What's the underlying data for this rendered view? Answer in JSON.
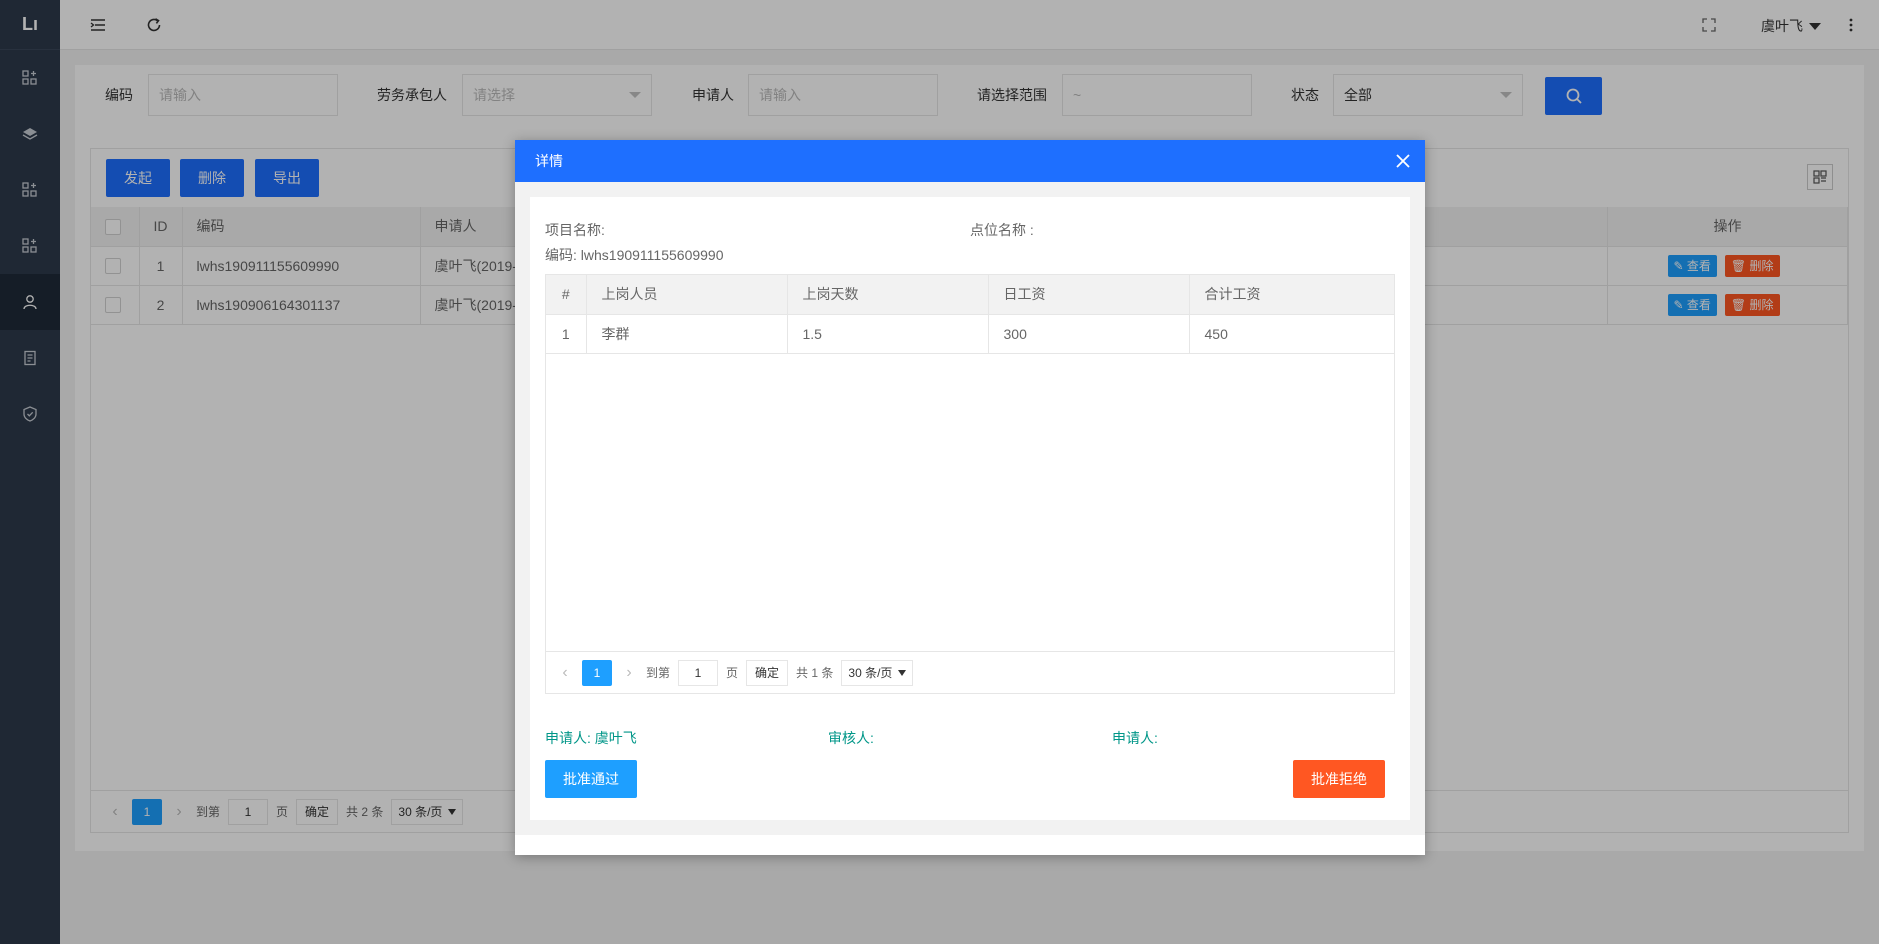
{
  "sidebar": {
    "logo": "Lı",
    "items": [
      {
        "icon": "dashboard-add-icon"
      },
      {
        "icon": "layers-icon"
      },
      {
        "icon": "dashboard-add-icon"
      },
      {
        "icon": "dashboard-add-icon"
      },
      {
        "icon": "user-icon"
      },
      {
        "icon": "document-icon"
      },
      {
        "icon": "shield-icon"
      }
    ]
  },
  "topbar": {
    "user_name": "虞叶飞"
  },
  "filters": {
    "code_label": "编码",
    "code_placeholder": "请输入",
    "contractor_label": "劳务承包人",
    "contractor_placeholder": "请选择",
    "applicant_label": "申请人",
    "applicant_placeholder": "请输入",
    "range_label": "请选择范围",
    "range_placeholder": "~",
    "status_label": "状态",
    "status_value": "全部"
  },
  "toolbar": {
    "launch_label": "发起",
    "delete_label": "删除",
    "export_label": "导出"
  },
  "main_table": {
    "columns": [
      "ID",
      "编码",
      "申请人",
      "操作"
    ],
    "rows": [
      {
        "id": "1",
        "code": "lwhs190911155609990",
        "applicant": "虞叶飞(2019-",
        "view": "查看",
        "delete": "删除"
      },
      {
        "id": "2",
        "code": "lwhs190906164301137",
        "applicant": "虞叶飞(2019-",
        "view": "查看",
        "delete": "删除"
      }
    ]
  },
  "main_pager": {
    "current_page": "1",
    "goto_label": "到第",
    "goto_value": "1",
    "page_unit": "页",
    "confirm_label": "确定",
    "total_label": "共 2 条",
    "page_size": "30 条/页"
  },
  "modal": {
    "title": "详情",
    "project_name_label": "项目名称:",
    "point_name_label": "点位名称 :",
    "code_line": "编码: lwhs190911155609990",
    "detail_columns": [
      "#",
      "上岗人员",
      "上岗天数",
      "日工资",
      "合计工资"
    ],
    "detail_rows": [
      {
        "no": "1",
        "person": "李群",
        "days": "1.5",
        "daily_wage": "300",
        "total_wage": "450"
      }
    ],
    "pager": {
      "current_page": "1",
      "goto_label": "到第",
      "goto_value": "1",
      "page_unit": "页",
      "confirm_label": "确定",
      "total_label": "共 1 条",
      "page_size": "30 条/页"
    },
    "applicant_sign": "申请人: 虞叶飞",
    "reviewer_sign": "审核人:",
    "applicant_sign2": "申请人:",
    "approve_label": "批准通过",
    "reject_label": "批准拒绝"
  },
  "colors": {
    "primary": "#1e6fff",
    "danger": "#ff5722",
    "sidebar_bg": "#2d3a4b",
    "sign_text": "#009688"
  }
}
